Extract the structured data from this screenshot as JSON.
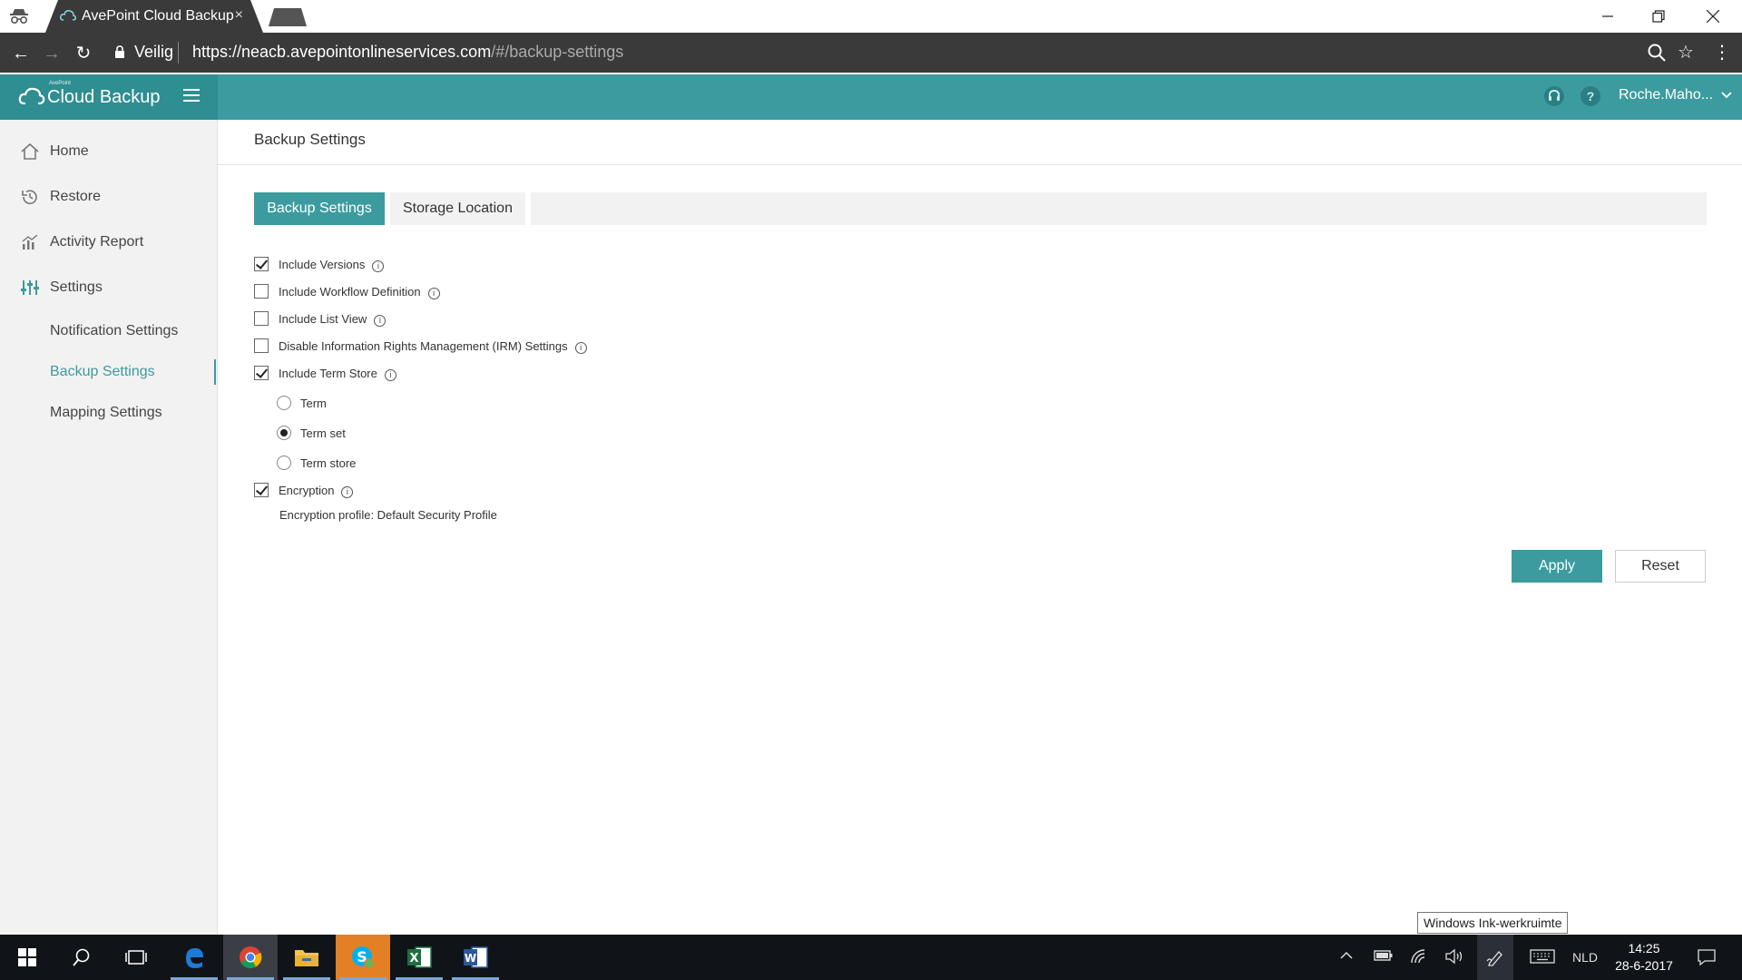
{
  "browser": {
    "tab_title": "AvePoint Cloud Backup",
    "tab_close": "×",
    "secure_label": "Veilig",
    "url_host": "https://neacb.avepointonlineservices.com",
    "url_path": "/#/backup-settings"
  },
  "header": {
    "brand_small": "AvePoint",
    "brand_name": "Cloud Backup",
    "user_name": "Roche.Maho...",
    "help_glyph": "?",
    "accent_color": "#3c9b9e"
  },
  "sidebar": {
    "items": [
      {
        "label": "Home",
        "icon": "home-icon"
      },
      {
        "label": "Restore",
        "icon": "history-icon"
      },
      {
        "label": "Activity Report",
        "icon": "bar-chart-icon"
      },
      {
        "label": "Settings",
        "icon": "sliders-icon"
      }
    ],
    "sub_items": [
      {
        "label": "Notification Settings",
        "active": false
      },
      {
        "label": "Backup Settings",
        "active": true
      },
      {
        "label": "Mapping Settings",
        "active": false
      }
    ]
  },
  "main": {
    "page_title": "Backup Settings",
    "tabs": [
      {
        "label": "Backup Settings",
        "active": true
      },
      {
        "label": "Storage Location",
        "active": false
      }
    ],
    "options": [
      {
        "label": "Include Versions",
        "checked": true
      },
      {
        "label": "Include Workflow Definition",
        "checked": false
      },
      {
        "label": "Include List View",
        "checked": false
      },
      {
        "label": "Disable Information Rights Management (IRM) Settings",
        "checked": false
      },
      {
        "label": "Include Term Store",
        "checked": true
      }
    ],
    "term_store_options": [
      {
        "label": "Term",
        "selected": false
      },
      {
        "label": "Term set",
        "selected": true
      },
      {
        "label": "Term store",
        "selected": false
      }
    ],
    "encryption": {
      "label": "Encryption",
      "checked": true,
      "profile_text": "Encryption profile: Default Security Profile"
    },
    "info_glyph": "i",
    "apply_label": "Apply",
    "reset_label": "Reset"
  },
  "tooltip": "Windows Ink-werkruimte",
  "taskbar": {
    "language": "NLD",
    "time": "14:25",
    "date": "28-6-2017"
  }
}
